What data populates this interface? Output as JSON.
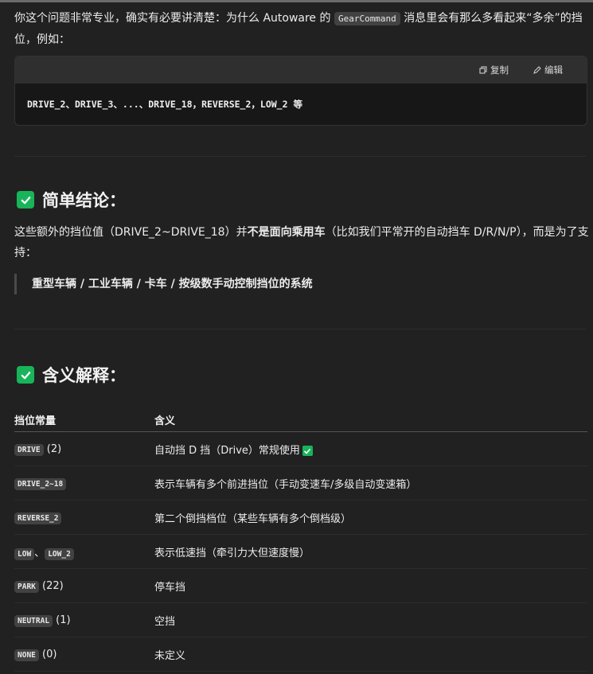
{
  "intro": {
    "part1": "你这个问题非常专业，确实有必要讲清楚：为什么 Autoware 的 ",
    "code": "GearCommand",
    "part2": " 消息里会有那么多看起来“多余”的挡位，例如："
  },
  "codeblock": {
    "copy_label": "复制",
    "edit_label": "编辑",
    "content": "DRIVE_2、DRIVE_3、...、DRIVE_18，REVERSE_2，LOW_2 等"
  },
  "section1": {
    "icon": "check-icon",
    "title": "简单结论：",
    "text_a": "这些额外的挡位值（DRIVE_2~DRIVE_18）并",
    "text_bold": "不是面向乘用车",
    "text_b": "（比如我们平常开的自动挡车 D/R/N/P），而是为了支持：",
    "quote": "重型车辆 / 工业车辆 / 卡车 / 按级数手动控制挡位的系统"
  },
  "section2": {
    "icon": "check-icon",
    "title": "含义解释：",
    "columns": [
      "挡位常量",
      "含义"
    ],
    "rows": [
      {
        "code": "DRIVE",
        "suffix": " (2)",
        "meaning": "自动挡 D 挡（Drive）常规使用",
        "check": true
      },
      {
        "code": "DRIVE_2~18",
        "suffix": "",
        "meaning": "表示车辆有多个前进挡位（手动变速车/多级自动变速箱）"
      },
      {
        "code": "REVERSE_2",
        "suffix": "",
        "meaning": "第二个倒挡档位（某些车辆有多个倒档级）"
      },
      {
        "code": "LOW",
        "sep": "、",
        "code2": "LOW_2",
        "suffix": "",
        "meaning": "表示低速挡（牵引力大但速度慢）"
      },
      {
        "code": "PARK",
        "suffix": " (22)",
        "meaning": "停车挡"
      },
      {
        "code": "NEUTRAL",
        "suffix": " (1)",
        "meaning": "空挡"
      },
      {
        "code": "NONE",
        "suffix": " (0)",
        "meaning": "未定义"
      }
    ]
  },
  "colors": {
    "accent_green": "#18b45a",
    "background": "#212121"
  }
}
